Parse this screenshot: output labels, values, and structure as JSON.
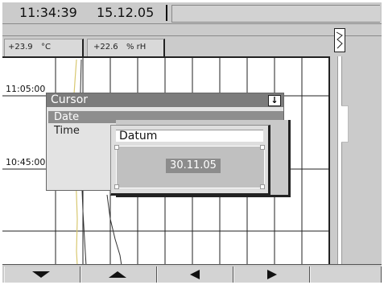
{
  "status_bar": {
    "time": "11:34:39",
    "date": "15.12.05"
  },
  "channels": [
    {
      "value": "+23.9",
      "unit": "°C"
    },
    {
      "value": "+22.6",
      "unit": "% rH"
    }
  ],
  "chart": {
    "time_labels": [
      "11:05:00",
      "10:45:00"
    ]
  },
  "cursor_menu": {
    "title": "Cursor",
    "dropdown_icon": "arrow-down-icon",
    "items": [
      {
        "label": "Date",
        "selected": true
      },
      {
        "label": "Time",
        "selected": false
      }
    ]
  },
  "date_dialog": {
    "title": "Datum",
    "value": "30.11.05"
  },
  "softkeys": [
    {
      "icon": "arrow-down-icon"
    },
    {
      "icon": "arrow-up-icon"
    },
    {
      "icon": "arrow-left-icon"
    },
    {
      "icon": "arrow-right-icon"
    },
    {
      "icon": ""
    }
  ],
  "colors": {
    "screen": "#cbcbcb",
    "trace_yellow": "#d8c870",
    "selection": "#8e8e8e"
  }
}
